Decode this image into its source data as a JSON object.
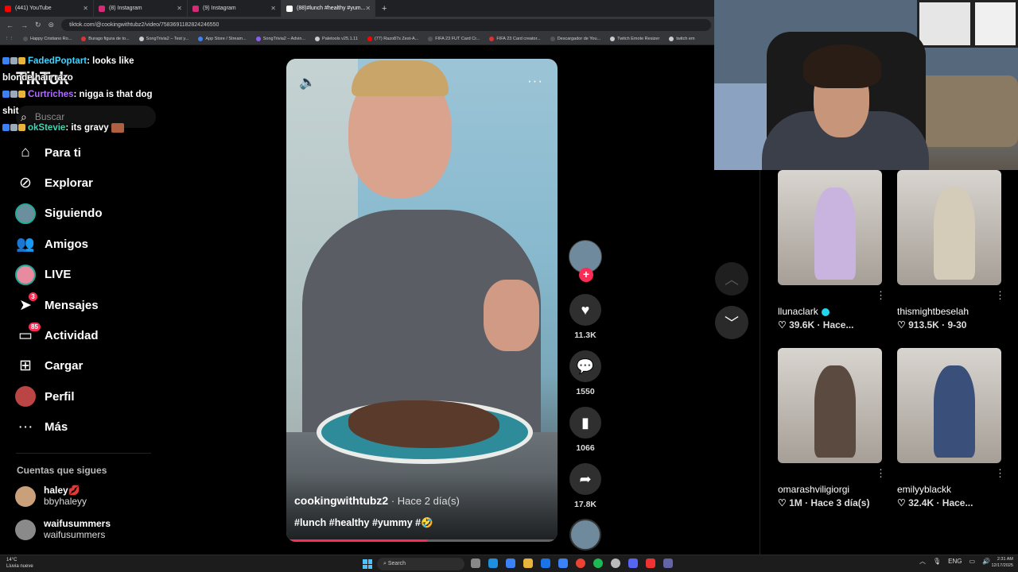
{
  "browser": {
    "tabs": [
      {
        "label": "(441) YouTube",
        "color": "#ff0000",
        "active": false
      },
      {
        "label": "(8) Instagram",
        "color": "#d62976",
        "active": false
      },
      {
        "label": "(9) Instagram",
        "color": "#d62976",
        "active": false
      },
      {
        "label": "(88)#lunch #healthy #yum...",
        "color": "#ffffff",
        "active": true
      }
    ],
    "url": "tiktok.com/@cookingwithtubz2/video/7583691182824246550",
    "bookmarks": [
      {
        "label": "Happy Cristiano Ro...",
        "color": "#555"
      },
      {
        "label": "Burago figura de to...",
        "color": "#d33"
      },
      {
        "label": "SongTrivia2 – Test y...",
        "color": "#ccc"
      },
      {
        "label": "App Store / Stream...",
        "color": "#3b82f6"
      },
      {
        "label": "SongTrivia2 – Advin...",
        "color": "#8b5cf6"
      },
      {
        "label": "Paletools v25.1.11",
        "color": "#ccc"
      },
      {
        "label": "(77) Razo87s Zest-A...",
        "color": "#ff0000"
      },
      {
        "label": "FIFA 23 FUT Card Cr...",
        "color": "#555"
      },
      {
        "label": "FIFA 23 Card creator...",
        "color": "#d33"
      },
      {
        "label": "Descargador de You...",
        "color": "#555"
      },
      {
        "label": "Twitch Emote Resizer",
        "color": "#ccc"
      },
      {
        "label": "twitch em",
        "color": "#ccc"
      }
    ]
  },
  "sidebar": {
    "logo": "TikTok",
    "search_placeholder": "Buscar",
    "nav": [
      {
        "label": "Para ti",
        "icon": "home-icon",
        "glyph": "⌂",
        "badge": ""
      },
      {
        "label": "Explorar",
        "icon": "compass-icon",
        "glyph": "⊘",
        "badge": ""
      },
      {
        "label": "Siguiendo",
        "icon": "following-avatar-icon",
        "glyph": "",
        "badge": ""
      },
      {
        "label": "Amigos",
        "icon": "friends-icon",
        "glyph": "👥",
        "badge": ""
      },
      {
        "label": "LIVE",
        "icon": "live-avatar-icon",
        "glyph": "",
        "badge": ""
      },
      {
        "label": "Mensajes",
        "icon": "send-icon",
        "glyph": "➤",
        "badge": "3"
      },
      {
        "label": "Actividad",
        "icon": "inbox-icon",
        "glyph": "▭",
        "badge": "85"
      },
      {
        "label": "Cargar",
        "icon": "upload-icon",
        "glyph": "⊞",
        "badge": ""
      },
      {
        "label": "Perfil",
        "icon": "profile-avatar-icon",
        "glyph": "",
        "badge": ""
      },
      {
        "label": "Más",
        "icon": "more-icon",
        "glyph": "···",
        "badge": ""
      }
    ],
    "following_title": "Cuentas que sigues",
    "following": [
      {
        "name": "haley💋",
        "handle": "bbyhaleyy"
      },
      {
        "name": "waifusummers",
        "handle": "waifusummers"
      }
    ]
  },
  "chat": [
    {
      "user": "FadedPoptart",
      "user_color": "#3fd3ff",
      "text": ": looks like blonde hair razo"
    },
    {
      "user": "Curtriches",
      "user_color": "#b06bff",
      "text": ": nigga is that dog shit"
    },
    {
      "user": "okStevie",
      "user_color": "#45d6b5",
      "text": ": its gravy"
    }
  ],
  "video": {
    "author": "cookingwithtubz2",
    "time": " · Hace 2 día(s)",
    "tags": "#lunch #healthy #yummy #🤣",
    "progress_percent": 52,
    "likes": "11.3K",
    "comments": "1550",
    "saves": "1066",
    "shares": "17.8K"
  },
  "related": [
    {
      "name": "llunaclark",
      "verified": true,
      "stats": "♡ 39.6K · Hace...",
      "color": "#c9b4e0"
    },
    {
      "name": "thismightbeselah",
      "verified": false,
      "stats": "♡ 913.5K · 9-30",
      "color": "#d4cbb8"
    },
    {
      "name": "omarashviligiorgi",
      "verified": false,
      "stats": "♡ 1M · Hace 3 día(s)",
      "color": "#5a4a40"
    },
    {
      "name": "emilyyblackk",
      "verified": false,
      "stats": "♡ 32.4K · Hace...",
      "color": "#3a4f7a"
    }
  ],
  "taskbar": {
    "weather_temp": "14°C",
    "weather_desc": "Lluvia nueve",
    "search": "Search",
    "lang": "ENG",
    "time": "2:31 AM",
    "date": "12/17/2025"
  }
}
